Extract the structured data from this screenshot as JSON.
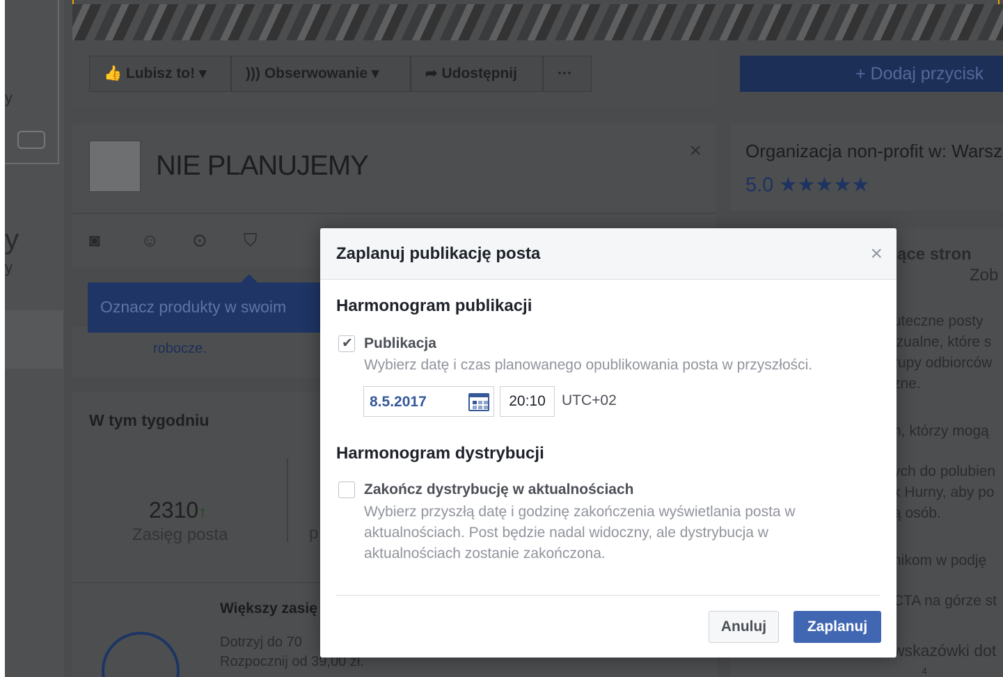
{
  "background": {
    "left": {
      "partial_chars": [
        "y",
        "y",
        "y"
      ]
    },
    "action_bar": {
      "like_label": "Lubisz to!",
      "follow_label": "Obserwowanie",
      "share_label": "Udostępnij",
      "more_label": "···",
      "cta_label": "+ Dodaj przycisk"
    },
    "composer": {
      "title": "NIE PLANUJEMY",
      "close": "×",
      "tooltip": "Oznacz produkty w swoim",
      "draft_text": "robocze."
    },
    "week": {
      "heading": "W tym tygodniu",
      "reach_value": "2310",
      "reach_arrow": "↑",
      "reach_label": "Zasięg posta",
      "second_label_partial": "p",
      "promo_heading": "Większy zasię",
      "promo_line1": "Dotrzyj do 70",
      "promo_line2": "Rozpocznij od 39,00 zł."
    },
    "right": {
      "org": "Organizacja non-profit w: Warsz",
      "rating": "5.0",
      "stars": "★★★★★",
      "side_lines": [
        "zące stron",
        "Zob",
        "uteczne posty",
        "izualne, które s",
        "rupy odbiorców",
        "zne.",
        "h, którzy mogą",
        "ych do polubien",
        "k Hurny, aby po",
        "ą osób.",
        "nikom w podję",
        "CTA na górze st",
        "wskazówki dot",
        "4"
      ]
    }
  },
  "modal": {
    "title": "Zaplanuj publikację posta",
    "close": "×",
    "publication": {
      "heading": "Harmonogram publikacji",
      "checked": true,
      "label": "Publikacja",
      "description": "Wybierz datę i czas planowanego opublikowania posta w przyszłości.",
      "date": "8.5.2017",
      "time": "20:10",
      "timezone": "UTC+02"
    },
    "distribution": {
      "heading": "Harmonogram dystrybucji",
      "checked": false,
      "label": "Zakończ dystrybucję w aktualnościach",
      "description": "Wybierz przyszłą datę i godzinę zakończenia wyświetlania posta w aktualnościach. Post będzie nadal widoczny, ale dystrybucja w aktualnościach zostanie zakończona."
    },
    "buttons": {
      "cancel": "Anuluj",
      "confirm": "Zaplanuj"
    }
  },
  "colors": {
    "overlay_bg": "#4a4b4d",
    "primary_button": "#4267b2",
    "link_blue": "#365899",
    "muted_text": "#90949c"
  }
}
